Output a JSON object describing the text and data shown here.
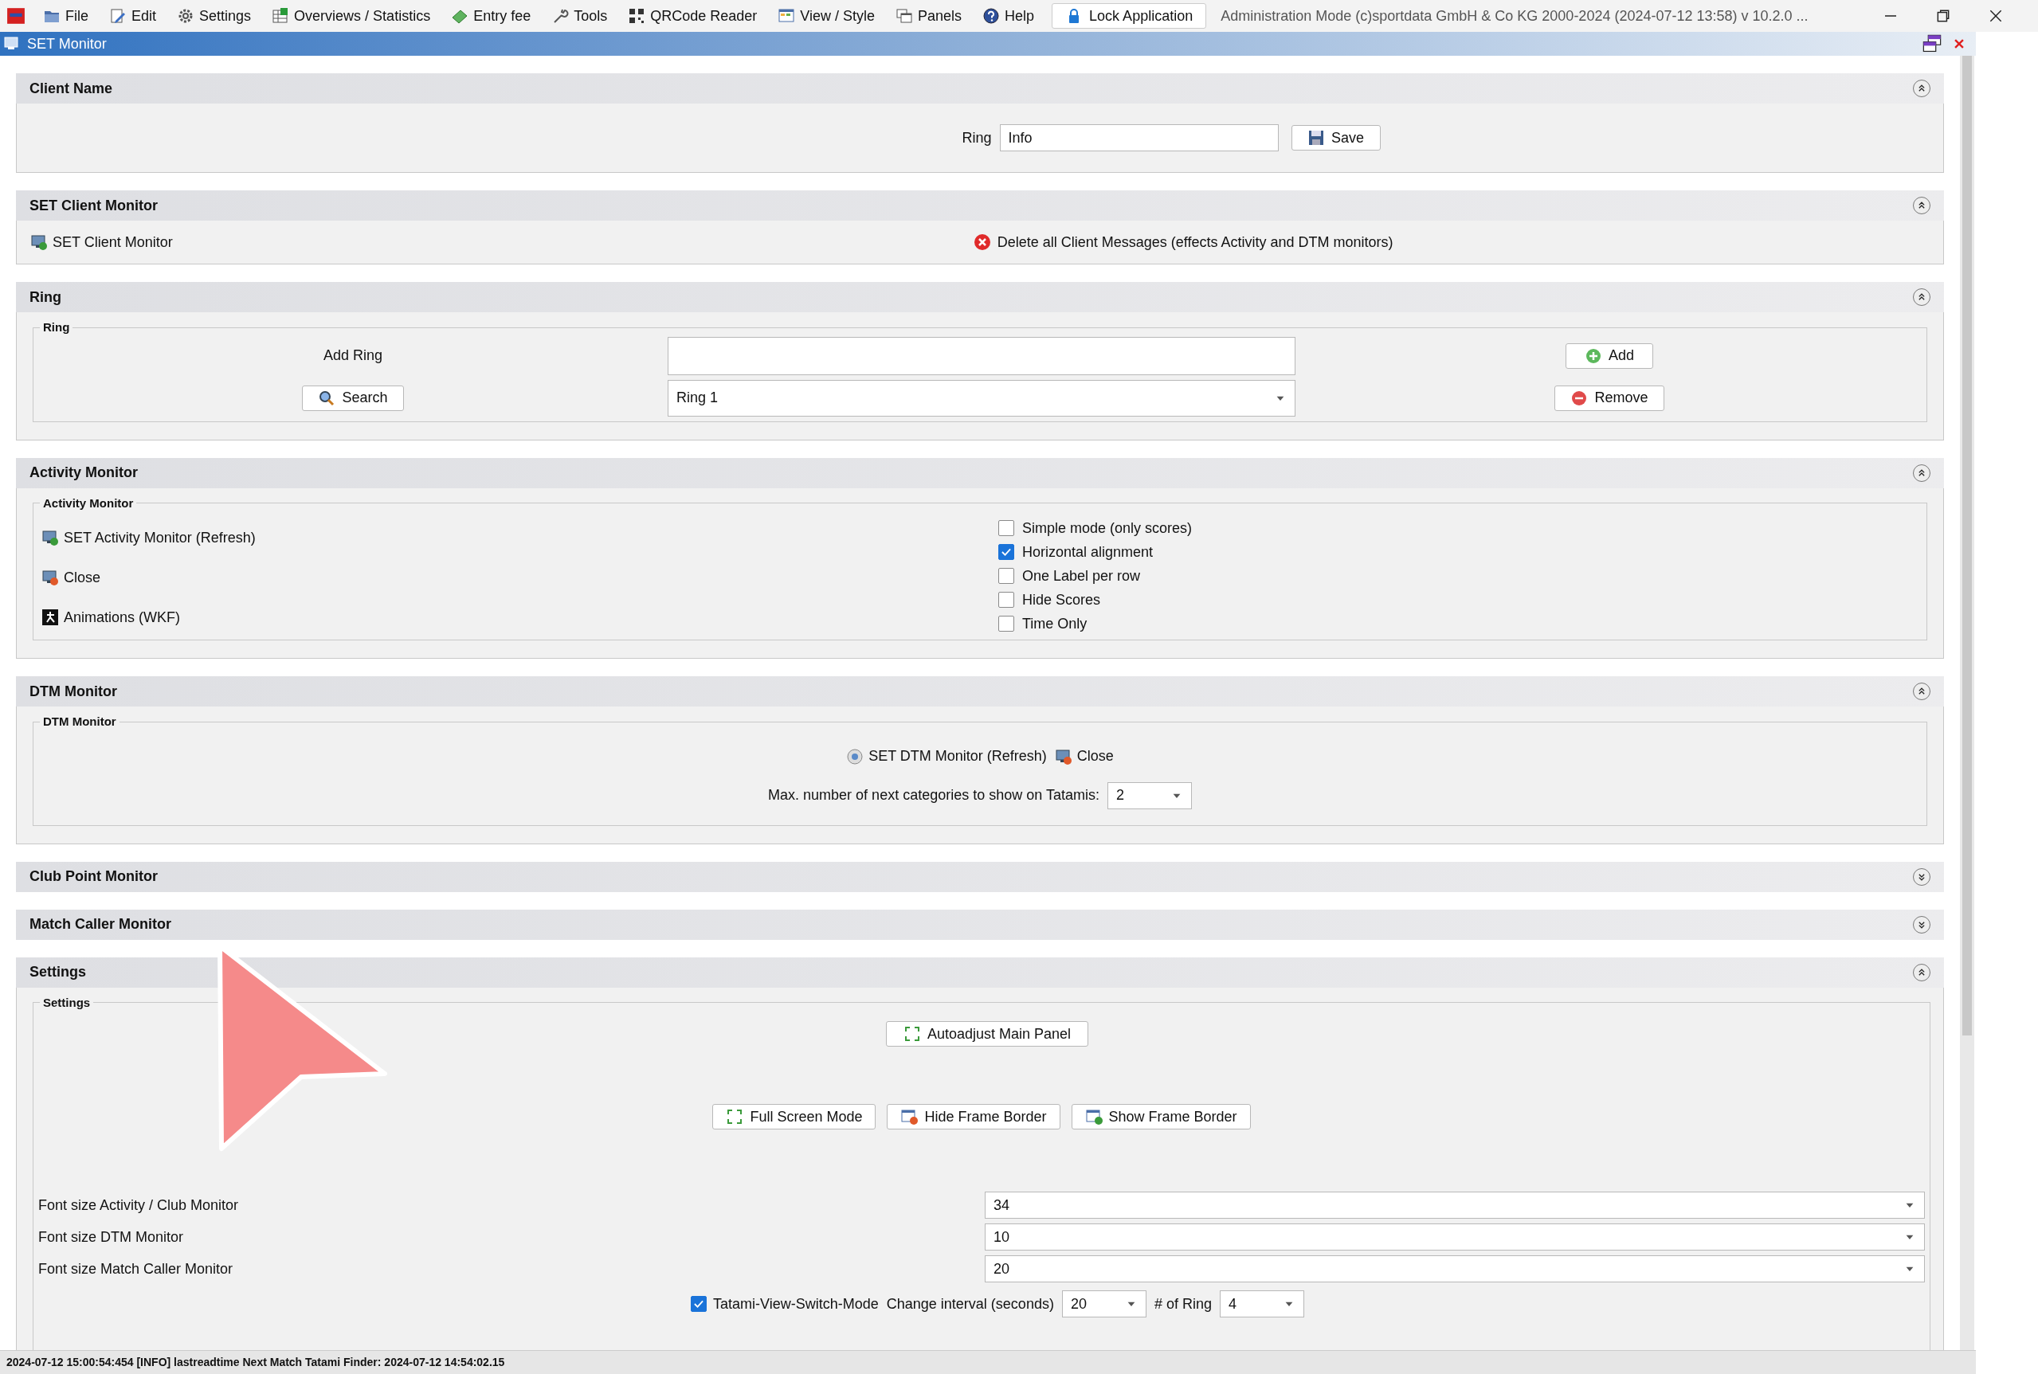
{
  "menu": [
    "File",
    "Edit",
    "Settings",
    "Overviews / Statistics",
    "Entry fee",
    "Tools",
    "QRCode Reader",
    "View / Style",
    "Panels",
    "Help"
  ],
  "lock_button": "Lock Application",
  "app_info": "Administration Mode (c)sportdata GmbH & Co KG 2000-2024 (2024-07-12 13:58)  v 10.2.0 ...",
  "window": {
    "title": "SET Monitor"
  },
  "sections": [
    {
      "kind": "client_name",
      "title": "Client Name",
      "expanded": true,
      "label": "Ring",
      "value": "Info",
      "button": "Save"
    },
    {
      "kind": "client_monitor",
      "title": "SET Client Monitor",
      "expanded": true,
      "link": "SET Client Monitor",
      "delete": "Delete all Client Messages (effects Activity and DTM monitors)"
    },
    {
      "kind": "ring",
      "title": "Ring",
      "expanded": true,
      "group": "Ring",
      "add_label": "Add Ring",
      "search": "Search",
      "select": "Ring 1",
      "add": "Add",
      "remove": "Remove"
    },
    {
      "kind": "activity",
      "title": "Activity Monitor",
      "expanded": true,
      "group": "Activity Monitor",
      "actions": [
        "SET Activity Monitor (Refresh)",
        "Close",
        "Animations (WKF)"
      ],
      "options": [
        {
          "label": "Simple mode (only scores)",
          "checked": false
        },
        {
          "label": "Horizontal alignment",
          "checked": true
        },
        {
          "label": "One Label per row",
          "checked": false
        },
        {
          "label": "Hide Scores",
          "checked": false
        },
        {
          "label": "Time Only",
          "checked": false
        }
      ]
    },
    {
      "kind": "dtm",
      "title": "DTM Monitor",
      "expanded": true,
      "group": "DTM Monitor",
      "refresh": "SET DTM Monitor (Refresh)",
      "close": "Close",
      "max_label": "Max. number of next categories to show on Tatamis:",
      "max_value": "2"
    },
    {
      "kind": "plain",
      "title": "Club Point Monitor",
      "expanded": false
    },
    {
      "kind": "plain",
      "title": "Match Caller Monitor",
      "expanded": false
    },
    {
      "kind": "settings",
      "title": "Settings",
      "expanded": true,
      "group": "Settings",
      "autoadjust": "Autoadjust Main Panel",
      "buttons": [
        "Full Screen Mode",
        "Hide Frame Border",
        "Show Frame Border"
      ],
      "font_sizes": [
        {
          "label": "Font size Activity / Club Monitor",
          "value": "34"
        },
        {
          "label": "Font size DTM Monitor",
          "value": "10"
        },
        {
          "label": "Font size Match Caller Monitor",
          "value": "20"
        }
      ],
      "switch_mode": {
        "label": "Tatami-View-Switch-Mode",
        "checked": true
      },
      "interval_label": "Change interval (seconds)",
      "interval_value": "20",
      "ring_label": "# of Ring",
      "ring_value": "4"
    }
  ],
  "status_bar": "2024-07-12 15:00:54:454 [INFO] lastreadtime Next Match Tatami Finder: 2024-07-12 14:54:02.15"
}
